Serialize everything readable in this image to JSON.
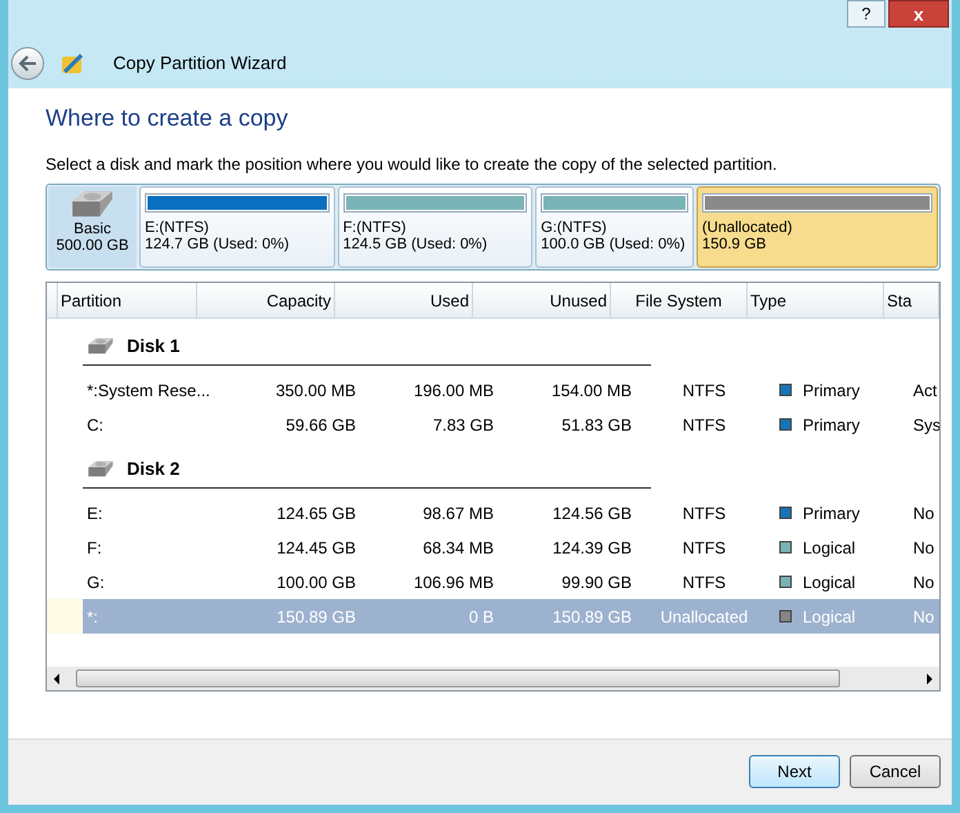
{
  "window": {
    "title": "Copy Partition Wizard",
    "help_button": "?",
    "close_button": "x"
  },
  "heading": "Where to create a copy",
  "instruction": "Select a disk and mark the position where you would like to create the copy of the selected partition.",
  "disk_map": {
    "disk_type": "Basic",
    "disk_size": "500.00 GB",
    "partitions": [
      {
        "label": "E:(NTFS)",
        "detail": "124.7 GB (Used: 0%)",
        "color": "#0b6fc0",
        "selected": false
      },
      {
        "label": "F:(NTFS)",
        "detail": "124.5 GB (Used: 0%)",
        "color": "#7ab3b6",
        "selected": false
      },
      {
        "label": "G:(NTFS)",
        "detail": "100.0 GB (Used: 0%)",
        "color": "#7ab3b6",
        "selected": false
      },
      {
        "label": "(Unallocated)",
        "detail": "150.9 GB",
        "color": "#8a8a8a",
        "selected": true
      }
    ]
  },
  "table": {
    "columns": [
      "Partition",
      "Capacity",
      "Used",
      "Unused",
      "File System",
      "Type",
      "Sta"
    ],
    "disks": [
      {
        "name": "Disk 1",
        "children": [
          {
            "cells": [
              "*:System Rese...",
              "350.00 MB",
              "196.00 MB",
              "154.00 MB",
              "NTFS",
              "Primary",
              "Act"
            ],
            "color": "#1874b8",
            "selected": false
          },
          {
            "cells": [
              "C:",
              "59.66 GB",
              "7.83 GB",
              "51.83 GB",
              "NTFS",
              "Primary",
              "Sys"
            ],
            "color": "#1874b8",
            "selected": false
          }
        ]
      },
      {
        "name": "Disk 2",
        "children": [
          {
            "cells": [
              "E:",
              "124.65 GB",
              "98.67 MB",
              "124.56 GB",
              "NTFS",
              "Primary",
              "No"
            ],
            "color": "#1874b8",
            "selected": false
          },
          {
            "cells": [
              "F:",
              "124.45 GB",
              "68.34 MB",
              "124.39 GB",
              "NTFS",
              "Logical",
              "No"
            ],
            "color": "#7ab3b6",
            "selected": false
          },
          {
            "cells": [
              "G:",
              "100.00 GB",
              "106.96 MB",
              "99.90 GB",
              "NTFS",
              "Logical",
              "No"
            ],
            "color": "#7ab3b6",
            "selected": false
          },
          {
            "cells": [
              "*:",
              "150.89 GB",
              "0 B",
              "150.89 GB",
              "Unallocated",
              "Logical",
              "No"
            ],
            "color": "#858585",
            "selected": true
          }
        ]
      }
    ]
  },
  "buttons": [
    "Next",
    "Cancel"
  ]
}
